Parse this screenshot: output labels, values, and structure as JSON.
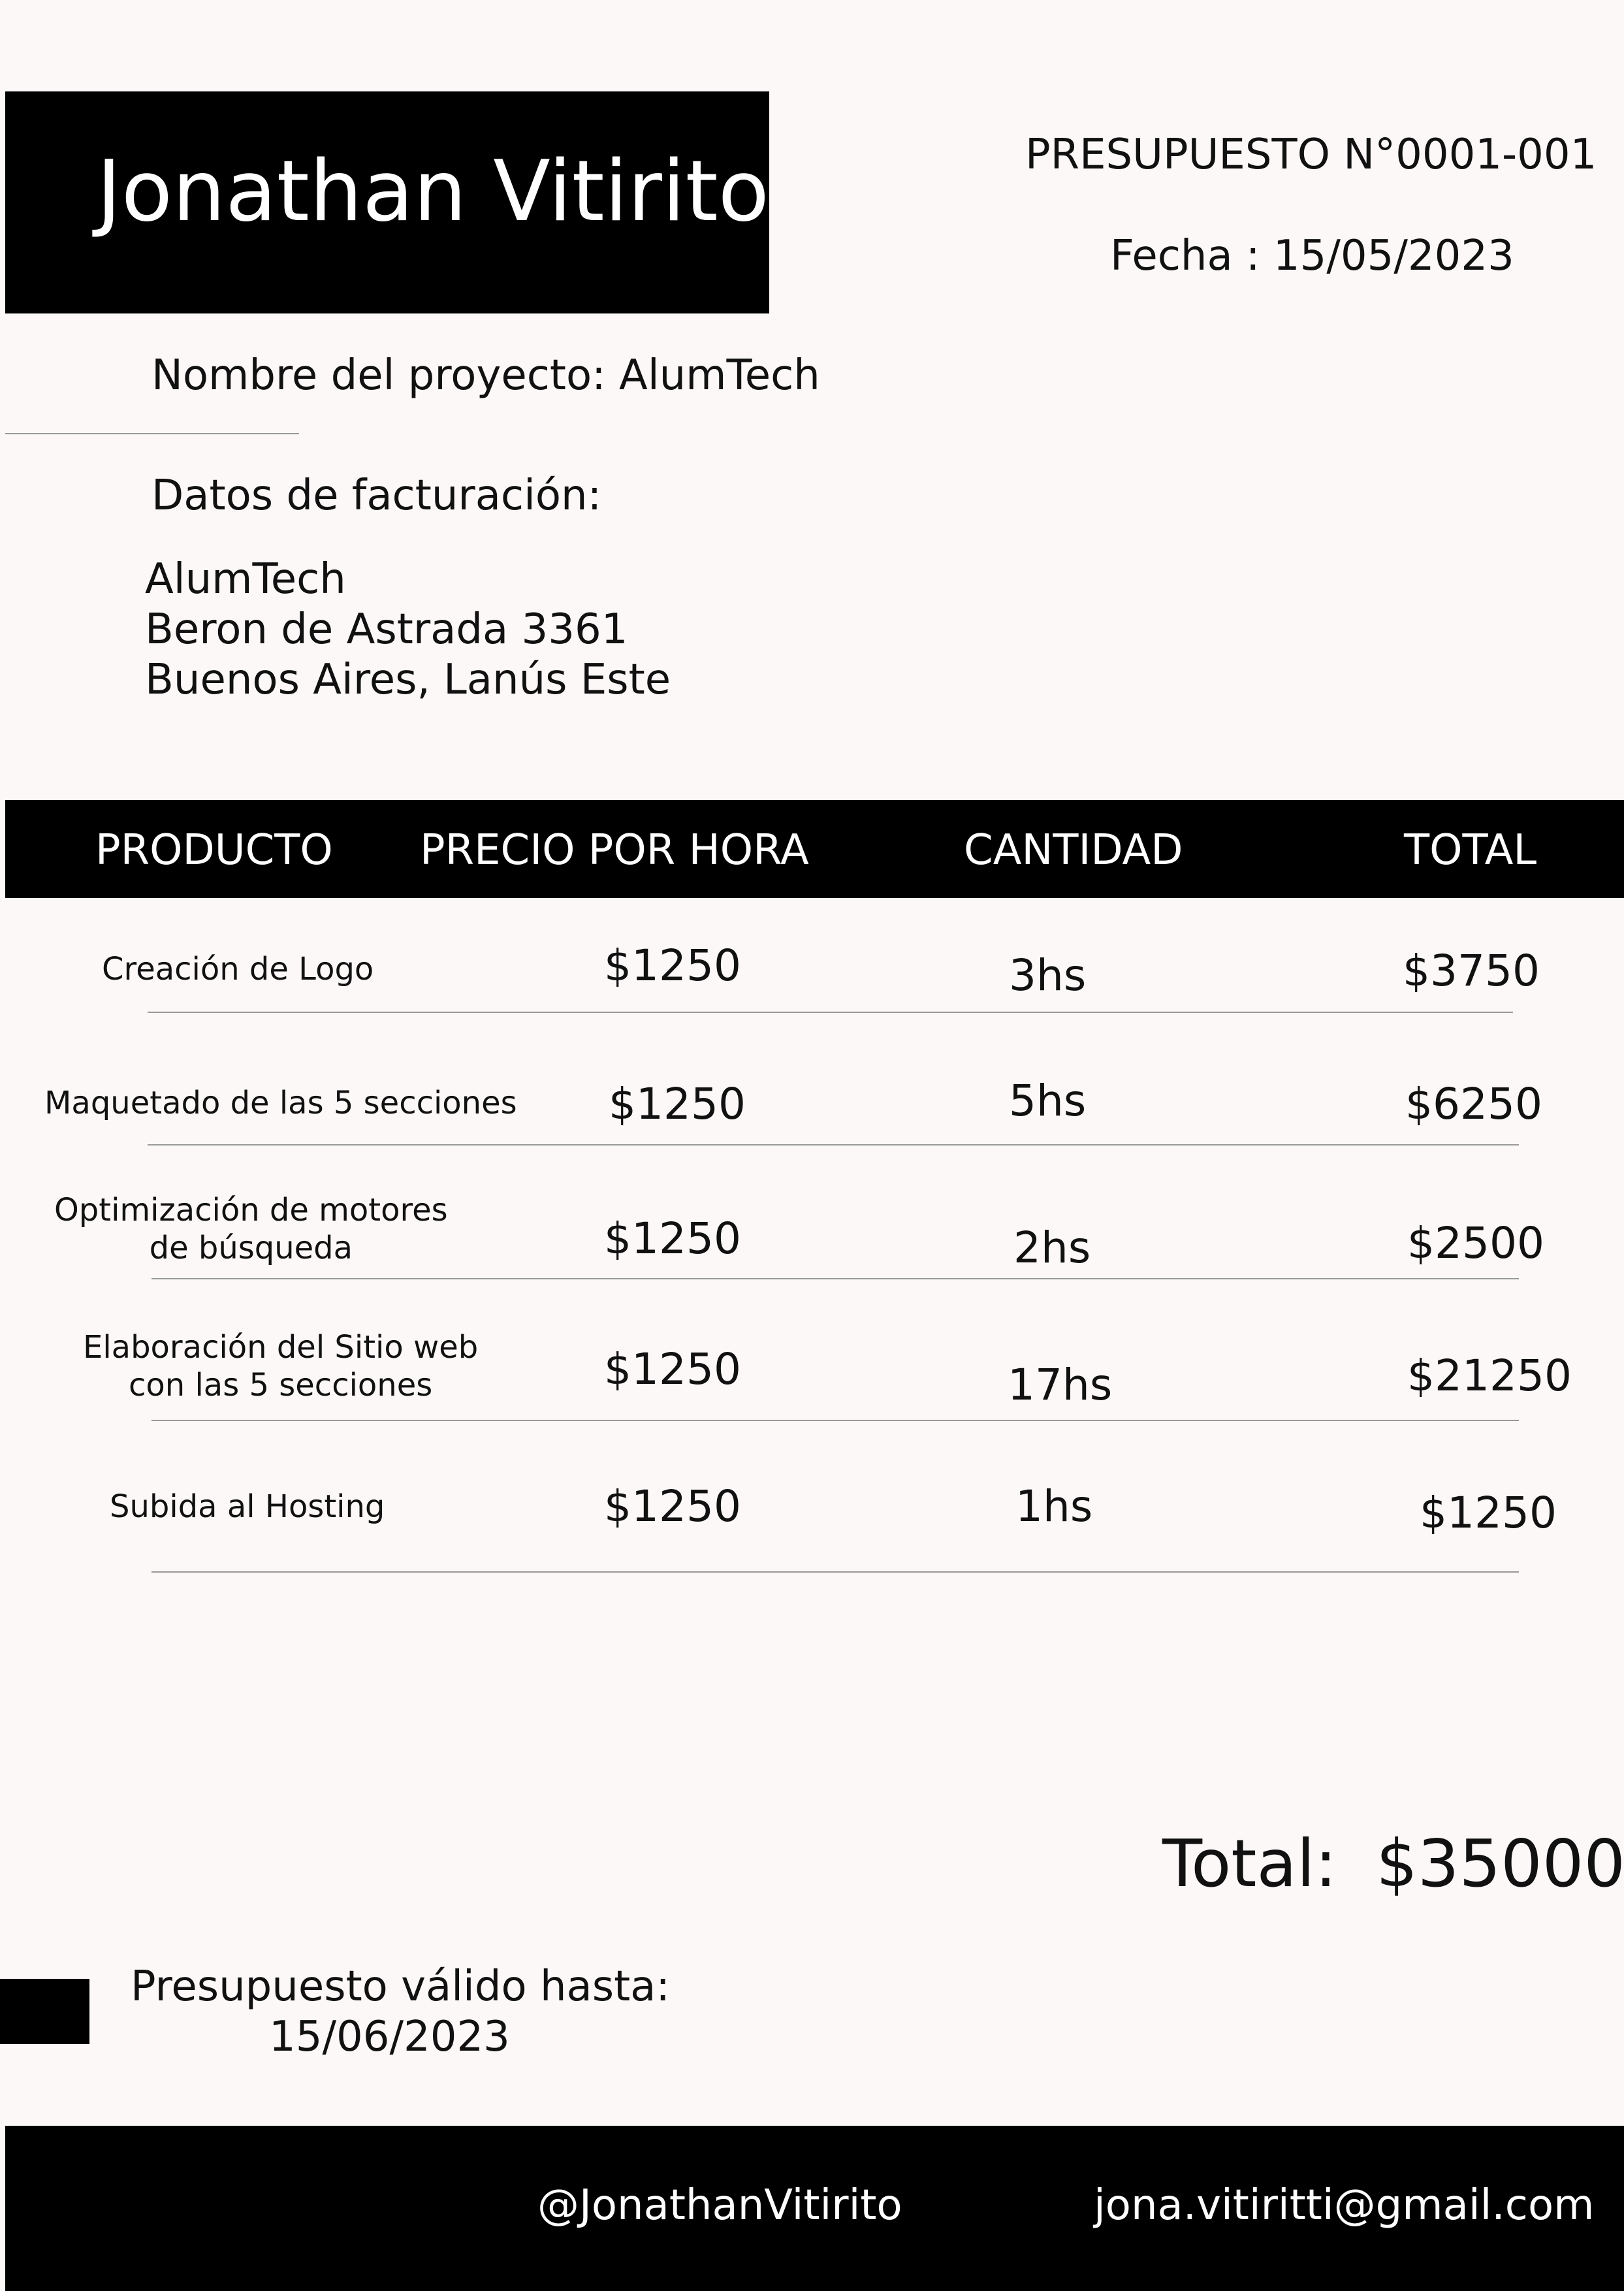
{
  "header": {
    "name": "Jonathan Vitirito",
    "quote_number": "PRESUPUESTO N°0001-001",
    "date": "Fecha : 15/05/2023"
  },
  "project": {
    "label": "Nombre del proyecto: AlumTech"
  },
  "billing": {
    "title": "Datos de facturación:",
    "company": "AlumTech",
    "address": "Beron de Astrada 3361",
    "city": "Buenos Aires, Lanús Este"
  },
  "table": {
    "headers": {
      "product": "PRODUCTO",
      "price": "PRECIO POR HORA",
      "quantity": "CANTIDAD",
      "total": "TOTAL"
    },
    "rows": [
      {
        "product": "Creación de Logo",
        "price": "$1250",
        "quantity": "3hs",
        "total": "$3750"
      },
      {
        "product": "Maquetado de las 5 secciones",
        "price": "$1250",
        "quantity": "5hs",
        "total": "$6250"
      },
      {
        "product": "Optimización de motores\nde búsqueda",
        "price": "$1250",
        "quantity": "2hs",
        "total": "$2500"
      },
      {
        "product": "Elaboración del Sitio web\ncon las 5 secciones",
        "price": "$1250",
        "quantity": "17hs",
        "total": "$21250"
      },
      {
        "product": "Subida al Hosting",
        "price": "$1250",
        "quantity": "1hs",
        "total": "$1250"
      }
    ]
  },
  "summary": {
    "total_label": "Total:",
    "total_value": "$35000"
  },
  "validity": {
    "label": "Presupuesto válido hasta:",
    "date": "15/06/2023"
  },
  "footer": {
    "social": "@JonathanVitirito",
    "email": "jona.vitiritti@gmail.com"
  }
}
